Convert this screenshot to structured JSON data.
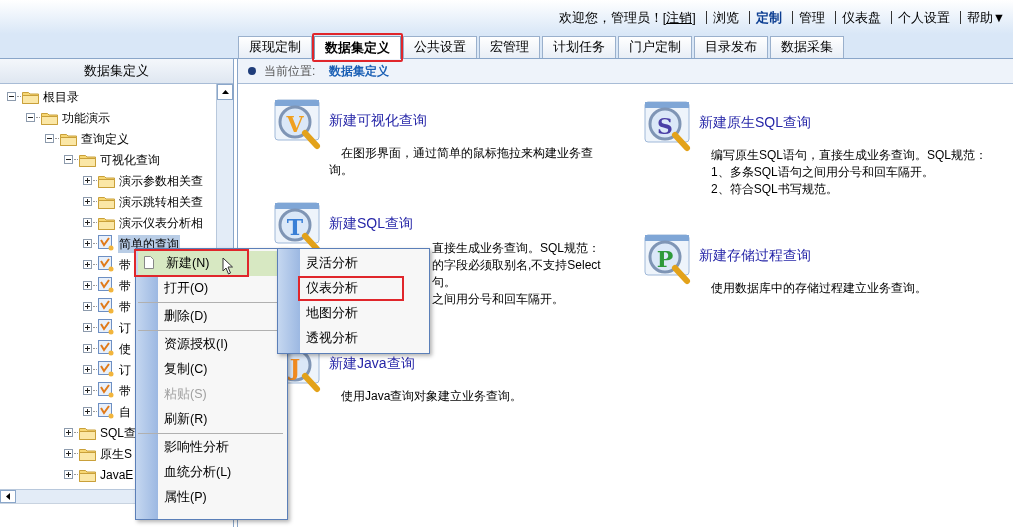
{
  "header": {
    "welcome": "欢迎您，管理员！",
    "logout": "[注销]",
    "links": [
      {
        "label": "浏览",
        "selected": false
      },
      {
        "label": "定制",
        "selected": true
      },
      {
        "label": "管理",
        "selected": false
      },
      {
        "label": "仪表盘",
        "selected": false
      },
      {
        "label": "个人设置",
        "selected": false
      },
      {
        "label": "帮助▼",
        "selected": false
      }
    ]
  },
  "tabs": [
    {
      "label": "展现定制",
      "selected": false
    },
    {
      "label": "数据集定义",
      "selected": true
    },
    {
      "label": "公共设置",
      "selected": false
    },
    {
      "label": "宏管理",
      "selected": false
    },
    {
      "label": "计划任务",
      "selected": false
    },
    {
      "label": "门户定制",
      "selected": false
    },
    {
      "label": "目录发布",
      "selected": false
    },
    {
      "label": "数据采集",
      "selected": false
    }
  ],
  "sidebar": {
    "title": "数据集定义",
    "tree": [
      {
        "label": "根目录",
        "kind": "folder",
        "expanded": true,
        "selected": false,
        "children": [
          {
            "label": "功能演示",
            "kind": "folder",
            "expanded": true,
            "selected": false,
            "children": [
              {
                "label": "查询定义",
                "kind": "folder",
                "expanded": true,
                "selected": false,
                "children": [
                  {
                    "label": "可视化查询",
                    "kind": "folder",
                    "expanded": true,
                    "selected": false,
                    "children": [
                      {
                        "label": "演示参数相关查",
                        "kind": "folder",
                        "expanded": false,
                        "selected": false
                      },
                      {
                        "label": "演示跳转相关查",
                        "kind": "folder",
                        "expanded": false,
                        "selected": false
                      },
                      {
                        "label": "演示仪表分析相",
                        "kind": "folder",
                        "expanded": false,
                        "selected": false
                      },
                      {
                        "label": "简单的查询",
                        "kind": "query",
                        "expanded": false,
                        "selected": true
                      },
                      {
                        "label": "带",
                        "kind": "query",
                        "expanded": false,
                        "selected": false
                      },
                      {
                        "label": "带",
                        "kind": "query",
                        "expanded": false,
                        "selected": false
                      },
                      {
                        "label": "带",
                        "kind": "query",
                        "expanded": false,
                        "selected": false
                      },
                      {
                        "label": "订",
                        "kind": "query",
                        "expanded": false,
                        "selected": false
                      },
                      {
                        "label": "使",
                        "kind": "query",
                        "expanded": false,
                        "selected": false
                      },
                      {
                        "label": "订",
                        "kind": "query",
                        "expanded": false,
                        "selected": false
                      },
                      {
                        "label": "带",
                        "kind": "query",
                        "expanded": false,
                        "selected": false
                      },
                      {
                        "label": "自",
                        "kind": "query",
                        "expanded": false,
                        "selected": false
                      }
                    ]
                  },
                  {
                    "label": "SQL查",
                    "kind": "folder",
                    "expanded": false,
                    "selected": false
                  },
                  {
                    "label": "原生S",
                    "kind": "folder",
                    "expanded": false,
                    "selected": false
                  },
                  {
                    "label": "JavaE",
                    "kind": "folder",
                    "expanded": false,
                    "selected": false
                  }
                ]
              }
            ]
          }
        ]
      }
    ]
  },
  "breadcrumb": {
    "label": "当前位置:",
    "current": "数据集定义"
  },
  "card_columns": [
    {
      "cards": [
        {
          "icon_letter": "V",
          "title": "新建可视化查询",
          "partly_hidden": false,
          "description_lines": [
            "　在图形界面，通过简单的鼠标拖拉来构建业务查询。"
          ]
        },
        {
          "icon_letter": "T",
          "title": "新建SQL查询",
          "partly_hidden": true,
          "description_lines": [
            "直接生成业务查询。SQL规范：",
            "的字段必须取别名,不支持Select",
            "句。",
            "之间用分号和回车隔开。"
          ]
        },
        {
          "icon_letter": "J",
          "title": "新建Java查询",
          "partly_hidden": false,
          "description_lines": [
            "　使用Java查询对象建立业务查询。"
          ]
        }
      ]
    },
    {
      "cards": [
        {
          "icon_letter": "S",
          "title": "新建原生SQL查询",
          "partly_hidden": false,
          "description_lines": [
            "　编写原生SQL语句，直接生成业务查询。SQL规范：",
            "　1、多条SQL语句之间用分号和回车隔开。",
            "　2、符合SQL书写规范。"
          ]
        },
        {
          "icon_letter": "P",
          "title": "新建存储过程查询",
          "partly_hidden": false,
          "description_lines": [
            "　使用数据库中的存储过程建立业务查询。"
          ]
        }
      ]
    }
  ],
  "context_menu": {
    "items": [
      {
        "kind": "item",
        "label": "新建(N)",
        "selected": true,
        "disabled": false
      },
      {
        "kind": "item",
        "label": "打开(O)",
        "selected": false,
        "disabled": false
      },
      {
        "kind": "separator"
      },
      {
        "kind": "item",
        "label": "删除(D)",
        "selected": false,
        "disabled": false
      },
      {
        "kind": "separator"
      },
      {
        "kind": "item",
        "label": "资源授权(I)",
        "selected": false,
        "disabled": false
      },
      {
        "kind": "item",
        "label": "复制(C)",
        "selected": false,
        "disabled": false
      },
      {
        "kind": "item",
        "label": "粘贴(S)",
        "selected": false,
        "disabled": true
      },
      {
        "kind": "item",
        "label": "刷新(R)",
        "selected": false,
        "disabled": false
      },
      {
        "kind": "separator"
      },
      {
        "kind": "item",
        "label": "影响性分析",
        "selected": false,
        "disabled": false
      },
      {
        "kind": "item",
        "label": "血统分析(L)",
        "selected": false,
        "disabled": false
      },
      {
        "kind": "item",
        "label": "属性(P)",
        "selected": false,
        "disabled": false
      }
    ]
  },
  "submenu": {
    "items": [
      {
        "label": "灵活分析",
        "marked": false
      },
      {
        "label": "仪表分析",
        "marked": true
      },
      {
        "label": "地图分析",
        "marked": false
      },
      {
        "label": "透视分析",
        "marked": false
      }
    ]
  },
  "annotations": {
    "tab_marked": true,
    "menu_item_marked": true
  }
}
